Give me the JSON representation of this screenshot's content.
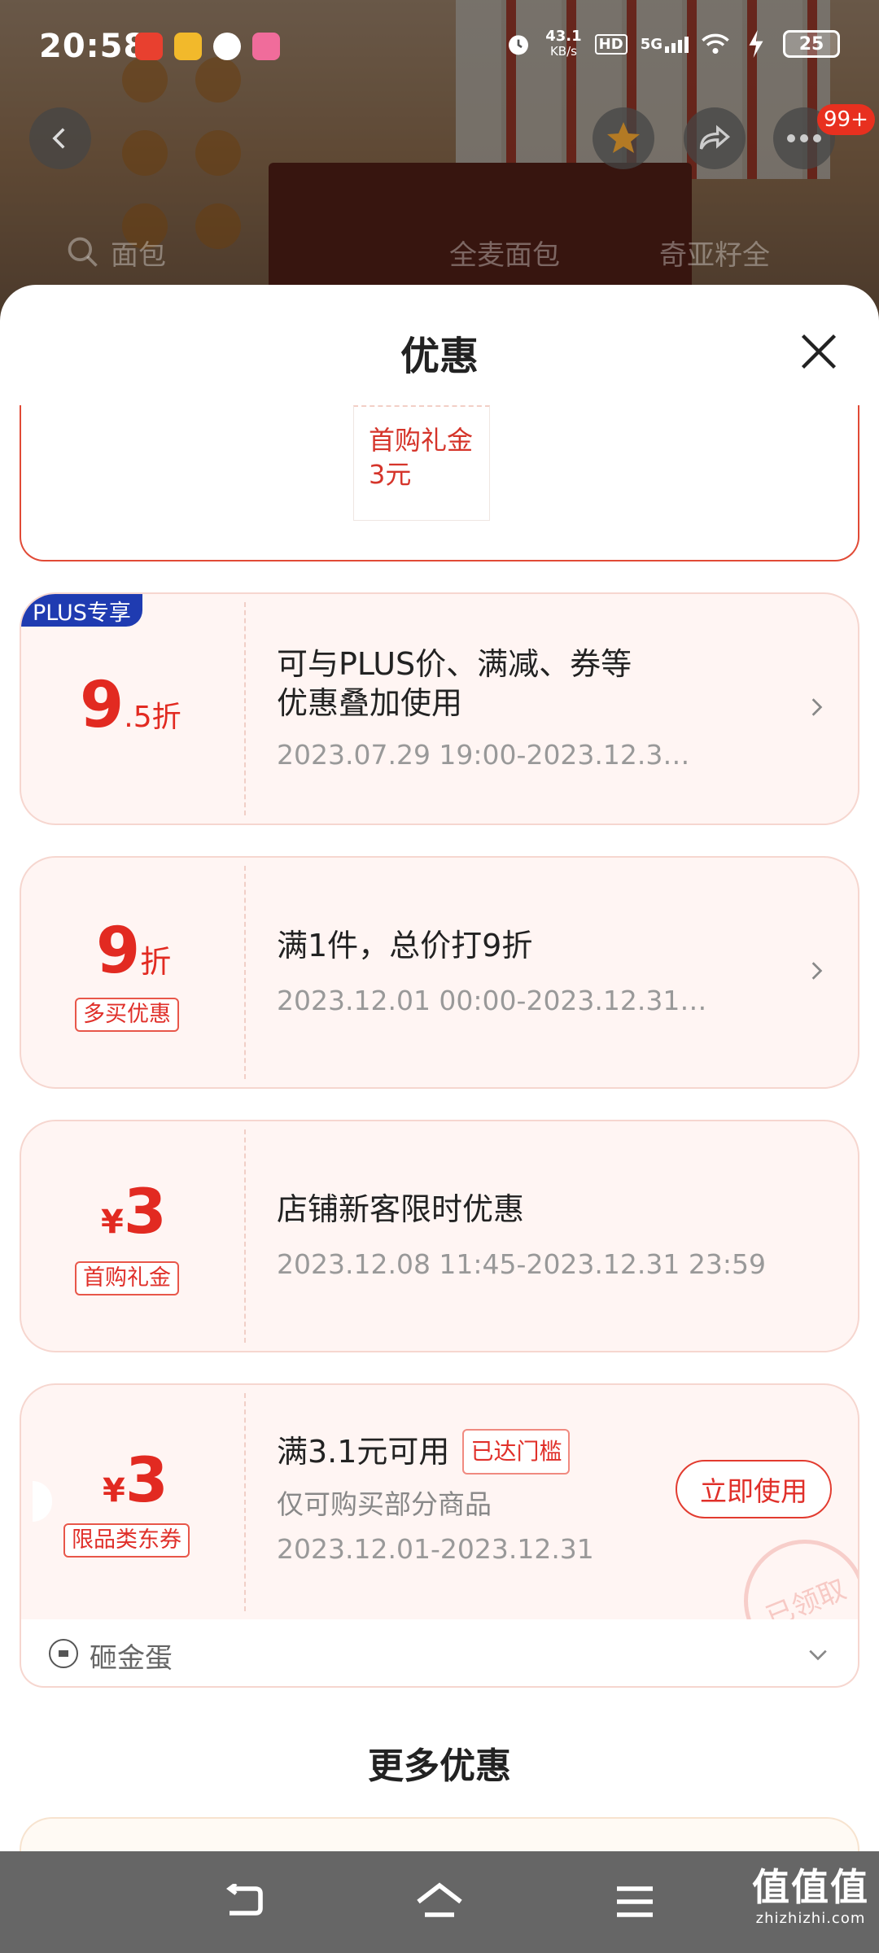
{
  "status_bar": {
    "time": "20:58",
    "net_speed_value": "43.1",
    "net_speed_unit": "KB/s",
    "hd": "HD",
    "signal": "5G",
    "battery": "25"
  },
  "background": {
    "badge": "99+",
    "tabs": [
      "面包",
      "全麦面包",
      "奇亚籽全"
    ]
  },
  "sheet": {
    "title": "优惠",
    "top_mini_coupon": {
      "line1": "首购礼金",
      "line2": "3元"
    }
  },
  "coupons": [
    {
      "badge": "PLUS专享",
      "value_big": "9",
      "value_small": ".5折",
      "title_line1": "可与PLUS价、满减、券等",
      "title_line2": "优惠叠加使用",
      "period": "2023.07.29 19:00-2023.12.3…"
    },
    {
      "value_big": "9",
      "value_small": "折",
      "tag": "多买优惠",
      "title": "满1件，总价打9折",
      "period": "2023.12.01 00:00-2023.12.31…"
    },
    {
      "currency": "¥",
      "value_big": "3",
      "tag": "首购礼金",
      "title": "店铺新客限时优惠",
      "period": "2023.12.08 11:45-2023.12.31 23:59"
    },
    {
      "currency": "¥",
      "value_big": "3",
      "tag": "限品类东券",
      "title": "满3.1元可用",
      "reached": "已达门槛",
      "note": "仅可购买部分商品",
      "period": "2023.12.01-2023.12.31",
      "button": "立即使用",
      "stamp": "已领取"
    }
  ],
  "egg": {
    "label": "砸金蛋"
  },
  "more": {
    "title": "更多优惠"
  },
  "watermark": {
    "big": "值值值",
    "small": "zhizhizhi.com"
  },
  "colors": {
    "accent": "#e22a21",
    "plus": "#1f3bb1",
    "card_bg": "#fff5f3"
  }
}
